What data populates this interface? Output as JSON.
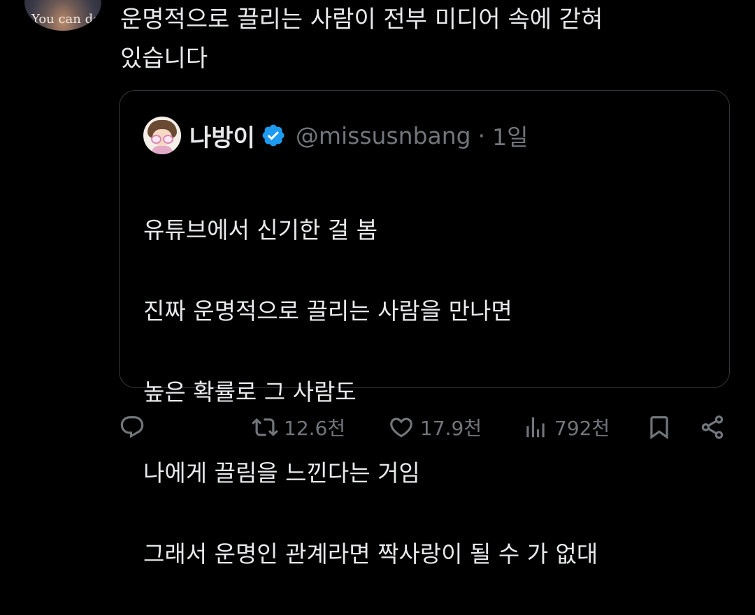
{
  "tweet": {
    "avatar_caption": "You can do it",
    "text": "운명적으로 끌리는 사람이 전부 미디어 속에 갇혀\n있습니다"
  },
  "quote": {
    "name": "나방이",
    "handle": "@missusnbang",
    "separator": "·",
    "time": "1일",
    "lines": [
      "유튜브에서 신기한 걸 봄",
      "진짜 운명적으로 끌리는 사람을 만나면",
      "높은 확률로 그 사람도",
      "나에게 끌림을 느낀다는 거임",
      "그래서 운명인 관계라면 짝사랑이 될 수 가 없대"
    ]
  },
  "actions": {
    "retweets": "12.6천",
    "likes": "17.9천",
    "views": "792천"
  },
  "colors": {
    "background": "#000000",
    "text": "#e7e9ea",
    "muted": "#71767b",
    "border": "#333639",
    "verified": "#1d9bf0"
  },
  "icons": {
    "reply": "reply-icon",
    "retweet": "retweet-icon",
    "like": "heart-icon",
    "views": "views-icon",
    "bookmark": "bookmark-icon",
    "share": "share-icon",
    "verified": "verified-badge-icon"
  }
}
